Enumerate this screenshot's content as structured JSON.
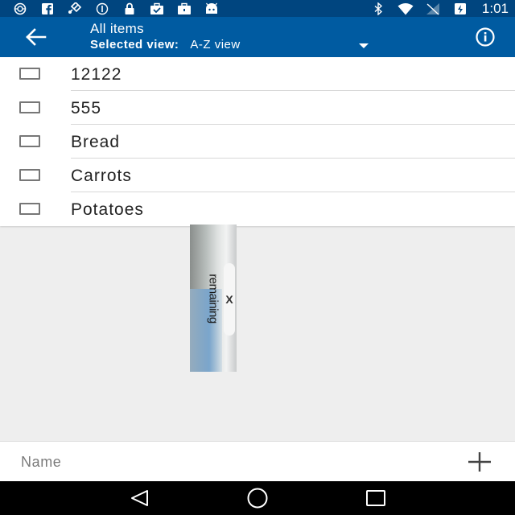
{
  "status_bar": {
    "time": "1:01",
    "left_icons": [
      "settings-wheel-icon",
      "facebook-icon",
      "satellite-icon",
      "minus-circle-icon",
      "lock-icon",
      "briefcase-check-icon",
      "briefcase-icon",
      "android-icon"
    ],
    "right_icons": [
      "bluetooth-icon",
      "wifi-icon",
      "no-signal-icon",
      "battery-charging-icon"
    ]
  },
  "app_bar": {
    "title": "All items",
    "selected_view_label": "Selected view:",
    "selected_view_value": "A-Z view"
  },
  "list": {
    "items": [
      {
        "label": "12122",
        "checked": false
      },
      {
        "label": "555",
        "checked": false
      },
      {
        "label": "Bread",
        "checked": false
      },
      {
        "label": "Carrots",
        "checked": false
      },
      {
        "label": "Potatoes",
        "checked": false
      }
    ]
  },
  "ad": {
    "text": "remaining",
    "close_glyph": "X"
  },
  "input_bar": {
    "placeholder": "Name"
  },
  "colors": {
    "status_bar": "#00457f",
    "app_bar": "#005ba1",
    "background": "#eeeeee",
    "nav_bar": "#000000"
  }
}
